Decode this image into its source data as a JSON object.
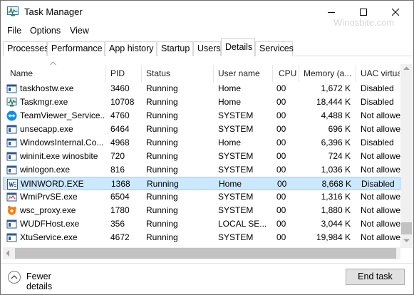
{
  "window": {
    "title": "Task Manager",
    "watermark": "Winosbite.com"
  },
  "menu": [
    "File",
    "Options",
    "View"
  ],
  "tabs": [
    "Processes",
    "Performance",
    "App history",
    "Startup",
    "Users",
    "Details",
    "Services"
  ],
  "active_tab": "Details",
  "columns": {
    "name": "Name",
    "pid": "PID",
    "status": "Status",
    "user": "User name",
    "cpu": "CPU",
    "memory": "Memory (a...",
    "uac": "UAC virtua"
  },
  "rows": [
    {
      "name": "taskhostw.exe",
      "pid": "3460",
      "status": "Running",
      "user": "Home",
      "cpu": "00",
      "memory": "1,672 K",
      "uac": "Disabled",
      "icon": "generic-app-icon"
    },
    {
      "name": "Taskmgr.exe",
      "pid": "10708",
      "status": "Running",
      "user": "Home",
      "cpu": "00",
      "memory": "18,444 K",
      "uac": "Disabled",
      "icon": "task-manager-icon"
    },
    {
      "name": "TeamViewer_Service....",
      "pid": "4760",
      "status": "Running",
      "user": "SYSTEM",
      "cpu": "00",
      "memory": "4,488 K",
      "uac": "Not allowed",
      "icon": "teamviewer-icon"
    },
    {
      "name": "unsecapp.exe",
      "pid": "6464",
      "status": "Running",
      "user": "SYSTEM",
      "cpu": "00",
      "memory": "696 K",
      "uac": "Not allowed",
      "icon": "generic-app-icon"
    },
    {
      "name": "WindowsInternal.Co...",
      "pid": "4968",
      "status": "Running",
      "user": "Home",
      "cpu": "00",
      "memory": "6,396 K",
      "uac": "Disabled",
      "icon": "generic-app-icon"
    },
    {
      "name": "wininit.exe winosbite",
      "pid": "720",
      "status": "Running",
      "user": "SYSTEM",
      "cpu": "00",
      "memory": "724 K",
      "uac": "Not allowed",
      "icon": "generic-app-icon"
    },
    {
      "name": "winlogon.exe",
      "pid": "816",
      "status": "Running",
      "user": "SYSTEM",
      "cpu": "00",
      "memory": "1,036 K",
      "uac": "Not allowed",
      "icon": "generic-app-icon"
    },
    {
      "name": "WINWORD.EXE",
      "pid": "1368",
      "status": "Running",
      "user": "Home",
      "cpu": "00",
      "memory": "8,668 K",
      "uac": "Disabled",
      "icon": "word-icon",
      "selected": true
    },
    {
      "name": "WmiPrvSE.exe",
      "pid": "6504",
      "status": "Running",
      "user": "SYSTEM",
      "cpu": "00",
      "memory": "1,316 K",
      "uac": "Not allowed",
      "icon": "wmi-icon"
    },
    {
      "name": "wsc_proxy.exe",
      "pid": "1780",
      "status": "Running",
      "user": "SYSTEM",
      "cpu": "00",
      "memory": "1,880 K",
      "uac": "Not allowed",
      "icon": "avast-icon"
    },
    {
      "name": "WUDFHost.exe",
      "pid": "356",
      "status": "Running",
      "user": "LOCAL SE...",
      "cpu": "00",
      "memory": "3,044 K",
      "uac": "Not allowed",
      "icon": "generic-app-icon"
    },
    {
      "name": "XtuService.exe",
      "pid": "4672",
      "status": "Running",
      "user": "SYSTEM",
      "cpu": "00",
      "memory": "19,984 K",
      "uac": "Not allowed",
      "icon": "generic-app-icon"
    }
  ],
  "footer": {
    "fewer_details": "Fewer details",
    "end_task": "End task"
  },
  "colors": {
    "selected_bg": "#cce8ff",
    "selected_border": "#99d1ff",
    "scroll_track": "#f0f0f0",
    "scroll_thumb": "#c2c2c2"
  }
}
